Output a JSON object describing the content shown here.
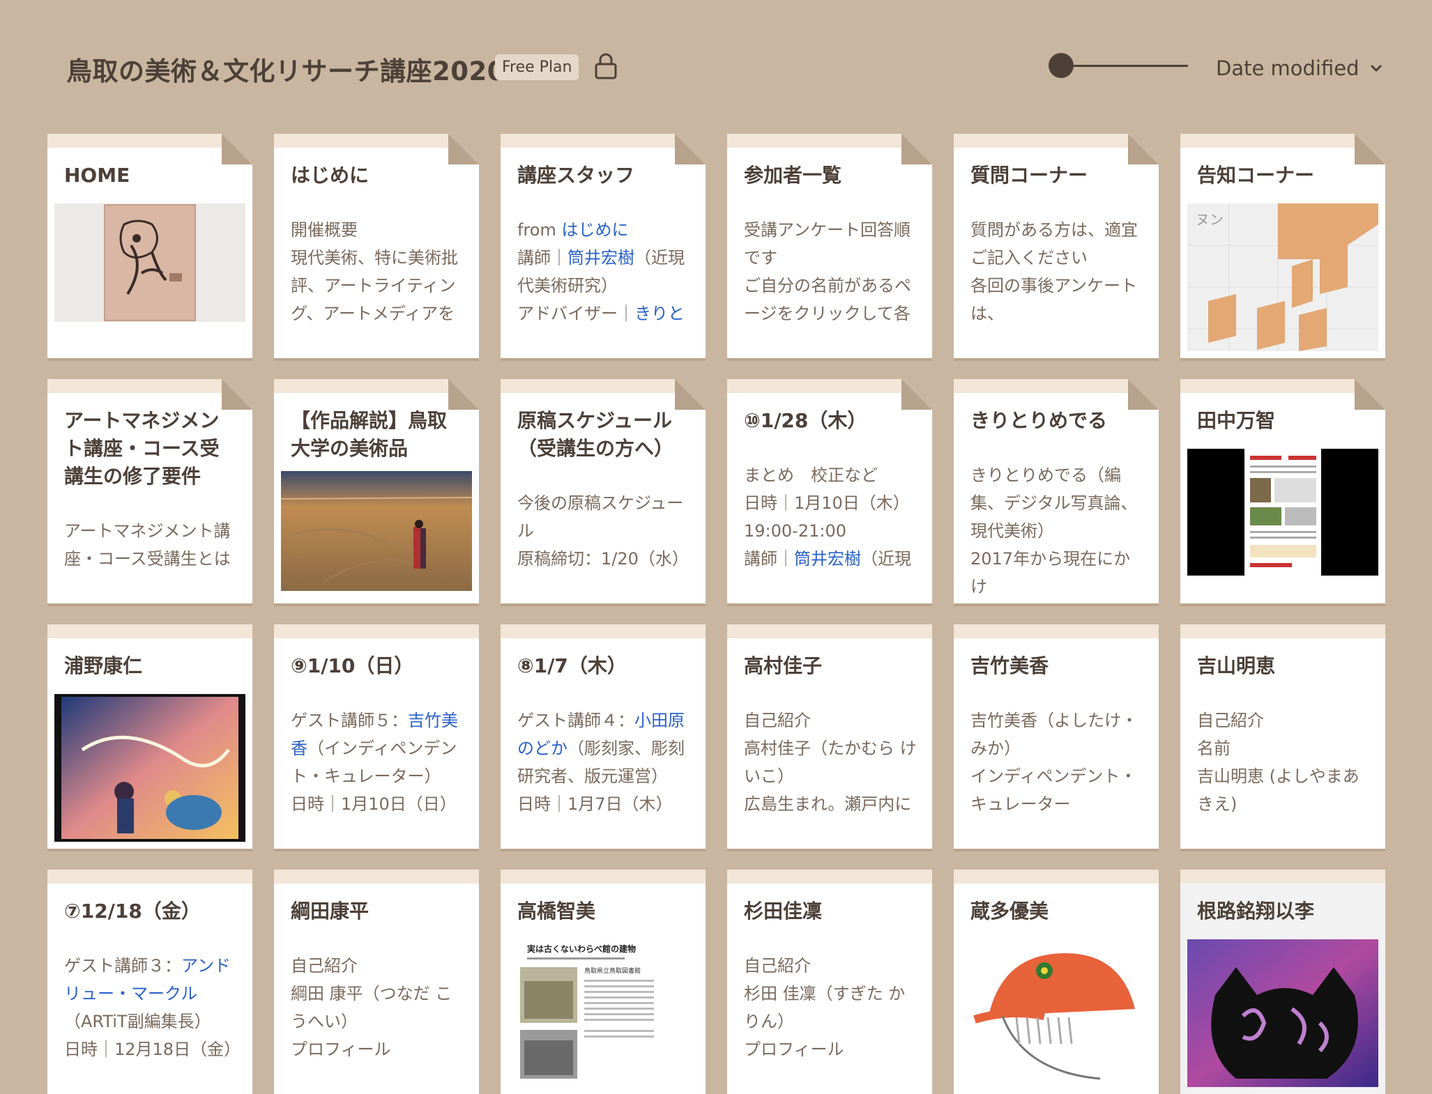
{
  "header": {
    "title": "鳥取の美術＆文化リサーチ講座2020",
    "plan_badge": "Free Plan",
    "sort_label": "Date modified"
  },
  "colors": {
    "background": "#c9b6a0",
    "card": "#ffffff",
    "tab": "#f1e6d8",
    "text_dark": "#4c4038",
    "text_body": "#7a6a5d",
    "link": "#2a62c9"
  },
  "cards": [
    {
      "title": "HOME",
      "thumb": "book-cover-image"
    },
    {
      "title": "はじめに",
      "lines": [
        "開催概要",
        "現代美術、特に美術批",
        "評、アートライティン",
        "グ、アートメディアを"
      ]
    },
    {
      "title": "講座スタッフ",
      "l1a": "from ",
      "l1b": "はじめに",
      "l2a": "講師｜",
      "l2b": "筒井宏樹",
      "l2c": "（近現",
      "l3": "代美術研究）",
      "l4a": "アドバイザー｜",
      "l4b": "きりと"
    },
    {
      "title": "参加者一覧",
      "lines": [
        "受講アンケート回答順",
        "です",
        "ご自分の名前があるペ",
        "ージをクリックして各"
      ]
    },
    {
      "title": "質問コーナー",
      "lines": [
        "質問がある方は、適宜",
        "ご記入ください",
        "各回の事後アンケート",
        "は、"
      ]
    },
    {
      "title": "告知コーナー",
      "thumb": "exhibition-poster-image",
      "thumb_text": "ヌン"
    },
    {
      "title": "アートマネジメント講座・コース受講生の修了要件",
      "lines": [
        "アートマネジメント講",
        "座・コース受講生とは"
      ]
    },
    {
      "title": "【作品解説】鳥取大学の美術品",
      "thumb": "painting-desert-image"
    },
    {
      "title": "原稿スケジュール（受講生の方へ）",
      "lines": [
        "今後の原稿スケジュー",
        "ル",
        "原稿締切：1/20（水）"
      ]
    },
    {
      "title": "⑩1/28（木）",
      "l1": "まとめ　校正など",
      "l2": "日時｜1月10日（木）",
      "l3": "19:00-21:00",
      "l4a": "講師｜",
      "l4b": "筒井宏樹",
      "l4c": "（近現"
    },
    {
      "title": "きりとりめでる",
      "lines": [
        "きりとりめでる（編",
        "集、デジタル写真論、",
        "現代美術）",
        "2017年から現在にかけ"
      ]
    },
    {
      "title": "田中万智",
      "thumb": "document-screenshot-image"
    },
    {
      "title": "浦野康仁",
      "thumb": "anime-poster-image"
    },
    {
      "title": "⑨1/10（日）",
      "l1a": "ゲスト講師５：",
      "l1b": "吉竹美",
      "l2a": "香",
      "l2b": "（インディペンデン",
      "l3": "ト・キュレーター）",
      "l4": "日時｜1月10日（日）"
    },
    {
      "title": "⑧1/7（木）",
      "l1a": "ゲスト講師４：",
      "l1b": "小田原",
      "l2a": "のどか",
      "l2b": "（彫刻家、彫刻",
      "l3": "研究者、版元運営）",
      "l4": "日時｜1月7日（木）"
    },
    {
      "title": "高村佳子",
      "lines": [
        "自己紹介",
        "高村佳子（たかむら け",
        "いこ）",
        "広島生まれ。瀬戸内に"
      ]
    },
    {
      "title": "吉竹美香",
      "lines": [
        "吉竹美香（よしたけ・",
        "みか）",
        "インディペンデント・",
        "キュレーター"
      ]
    },
    {
      "title": "吉山明恵",
      "lines": [
        "自己紹介",
        "名前",
        "吉山明恵 (よしやまあ",
        "きえ)"
      ]
    },
    {
      "title": "⑦12/18（金）",
      "l1a": "ゲスト講師３：",
      "l1b": "アンド",
      "l2": "リュー・マークル",
      "l3": "（ARTiT副編集長）",
      "l4": "日時｜12月18日（金）"
    },
    {
      "title": "綱田康平",
      "lines": [
        "自己紹介",
        "綱田 康平（つなだ こ",
        "うへい）",
        "プロフィール"
      ]
    },
    {
      "title": "高橋智美",
      "thumb": "article-scan-image",
      "thumb_heading": "実は古くないわらべ館の建物",
      "thumb_sub": "鳥取県立鳥取図書館"
    },
    {
      "title": "杉田佳凜",
      "lines": [
        "自己紹介",
        "杉田 佳凜（すぎた か",
        "りん）",
        "プロフィール"
      ]
    },
    {
      "title": "蔵多優美",
      "thumb": "cap-character-illustration"
    },
    {
      "title": "根路銘翔以李",
      "thumb": "cat-logo-artwork"
    }
  ]
}
